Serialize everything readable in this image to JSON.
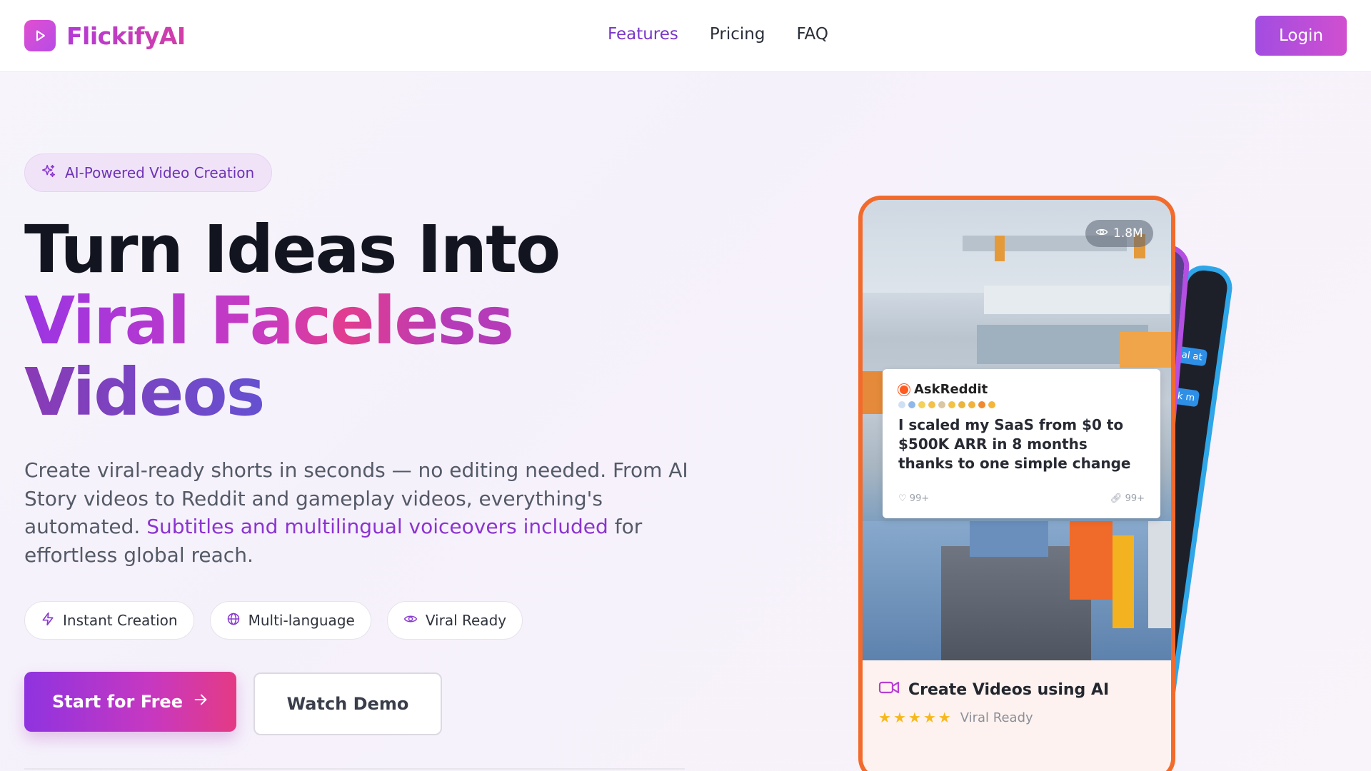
{
  "header": {
    "brand": "FlickifyAI",
    "nav": [
      "Features",
      "Pricing",
      "FAQ"
    ],
    "active_nav": "Features",
    "login_label": "Login"
  },
  "hero": {
    "badge": "AI-Powered Video Creation",
    "headline": [
      "Turn Ideas Into",
      "Viral Faceless",
      "Videos"
    ],
    "description_plain": "Create viral-ready shorts in seconds — no editing needed. From AI Story videos to Reddit and gameplay videos, everything's automated. ",
    "description_highlight": "Subtitles and multilingual voiceovers included",
    "description_end": " for effortless global reach.",
    "chips": [
      "Instant Creation",
      "Multi-language",
      "Viral Ready"
    ],
    "cta_primary": "Start for Free",
    "cta_secondary": "Watch Demo"
  },
  "phone": {
    "views": "1.8M",
    "subreddit": "AskReddit",
    "post_title": "I scaled my SaaS from $0 to $500K ARR in 8 months thanks to one simple change",
    "upvotes": "99+",
    "shares": "99+",
    "footer_title": "Create Videos using AI",
    "rating_stars": 5,
    "rating_label": "Viral Ready",
    "back_pills": [
      "al at",
      "k m"
    ]
  },
  "colors": {
    "brand_purple": "#9b35e3",
    "brand_pink": "#e23c8f",
    "phone_border": "#f26b2c",
    "accent_blue": "#3b6ee6"
  },
  "icons": {
    "logo": "play-icon",
    "badge": "sparkles-icon",
    "chip_0": "lightning-icon",
    "chip_1": "globe-icon",
    "chip_2": "eye-icon",
    "cta": "arrow-right-icon",
    "views": "eye-icon",
    "footer": "video-camera-icon"
  }
}
